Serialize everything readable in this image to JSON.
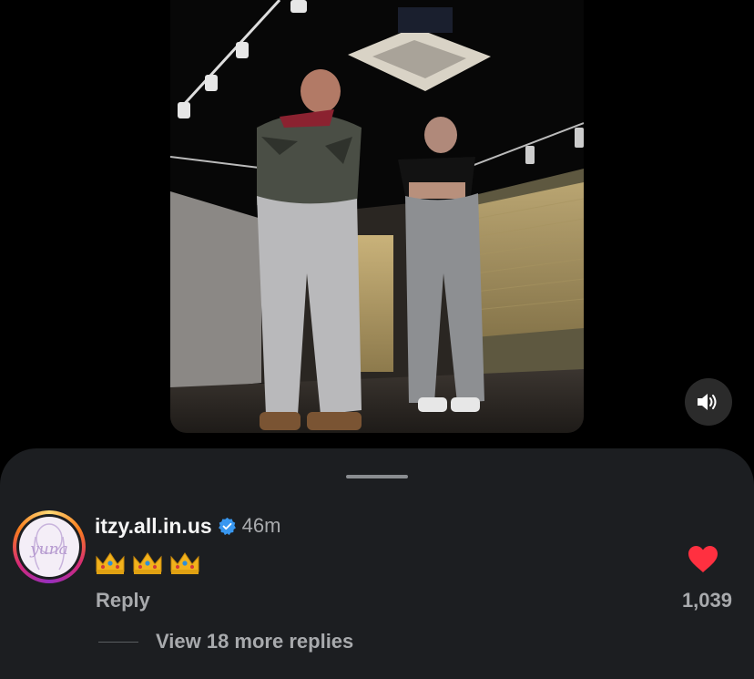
{
  "video": {
    "description_icon": "video-frame",
    "sound_icon": "speaker-on-icon"
  },
  "comment": {
    "username": "itzy.all.in.us",
    "time": "46m",
    "avatar_text": "yuna",
    "verified_icon": "verified-badge-icon",
    "text": "👑👑👑",
    "reply_label": "Reply",
    "likes": "1,039",
    "heart_icon": "heart-filled-icon",
    "heart_color": "#ff3040"
  },
  "replies": {
    "view_more": "View 18 more replies"
  }
}
